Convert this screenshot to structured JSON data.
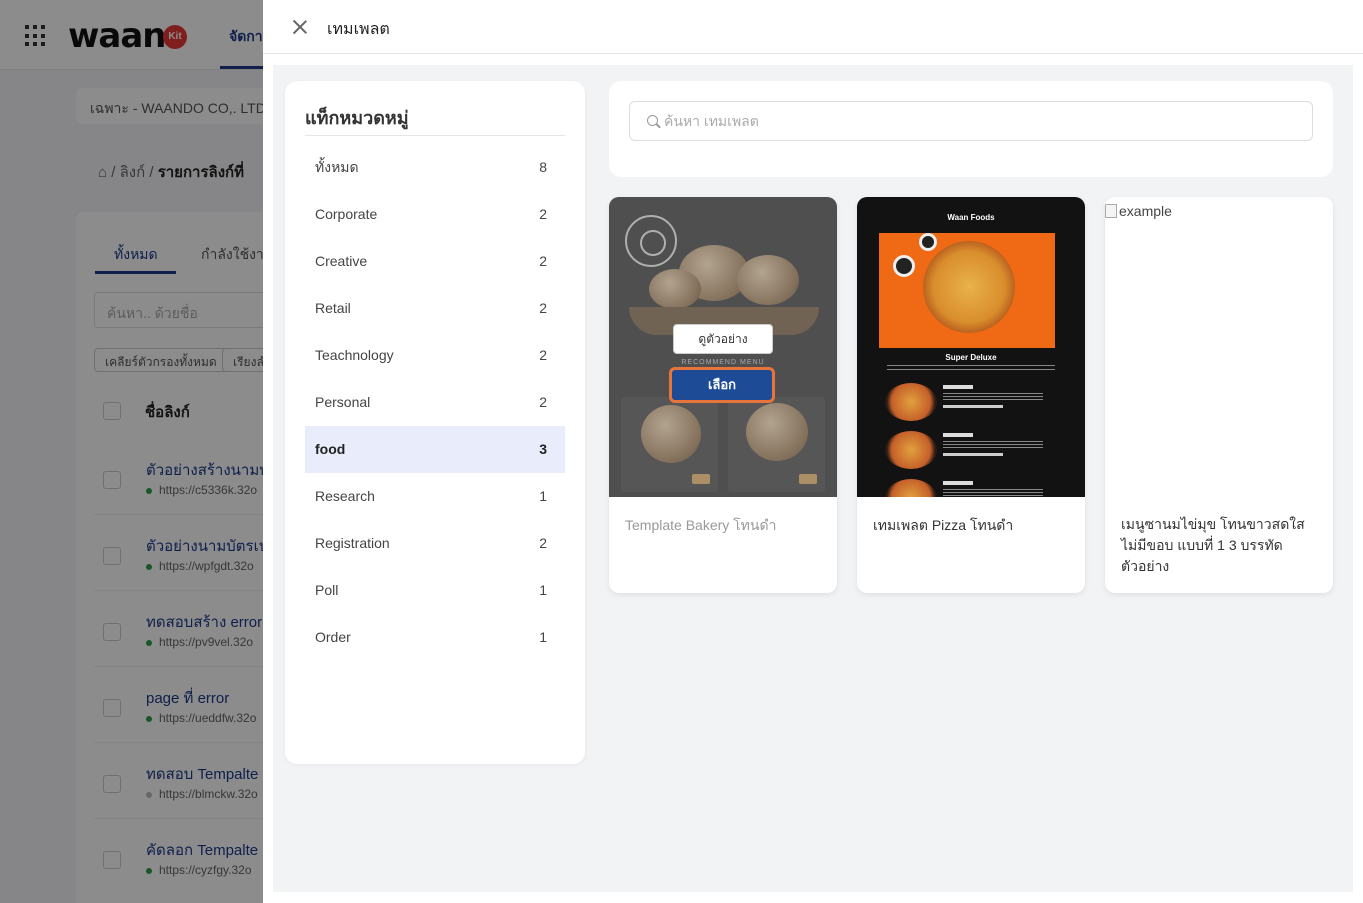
{
  "background": {
    "logo": "waan",
    "logo_badge": "Kit",
    "menu_label": "จัดการ",
    "org": "เฉพาะ - WAANDO CO,. LTD.",
    "breadcrumb": {
      "link": "ลิงก์",
      "current": "รายการลิงก์ที่"
    },
    "tabs": [
      "ทั้งหมด",
      "กำลังใช้งาน"
    ],
    "search_placeholder": "ค้นหา.. ด้วยชื่อ",
    "chips": [
      "เคลียร์ตัวกรองทั้งหมด",
      "เรียงลำ"
    ],
    "column_header": "ชื่อลิงก์",
    "rows": [
      {
        "title": "ตัวอย่างสร้างนามบั",
        "url": "https://c5336k.32o",
        "active": true
      },
      {
        "title": "ตัวอย่างนามบัตรเป",
        "url": "https://wpfgdt.32o",
        "active": true
      },
      {
        "title": "ทดสอบสร้าง error",
        "url": "https://pv9vel.32o",
        "active": true
      },
      {
        "title": "page ที่ error",
        "url": "https://ueddfw.32o",
        "active": true
      },
      {
        "title": "ทดสอบ Tempalte",
        "url": "https://blmckw.32o",
        "active": false
      },
      {
        "title": "คัดลอก Tempalte",
        "url": "https://cyzfgy.32o",
        "active": true
      }
    ]
  },
  "drawer": {
    "title": "เทมเพลต",
    "categories_title": "แท็กหมวดหมู่",
    "categories": [
      {
        "label": "ทั้งหมด",
        "count": "8",
        "active": false
      },
      {
        "label": "Corporate",
        "count": "2",
        "active": false
      },
      {
        "label": "Creative",
        "count": "2",
        "active": false
      },
      {
        "label": "Retail",
        "count": "2",
        "active": false
      },
      {
        "label": "Teachnology",
        "count": "2",
        "active": false
      },
      {
        "label": "Personal",
        "count": "2",
        "active": false
      },
      {
        "label": "food",
        "count": "3",
        "active": true
      },
      {
        "label": "Research",
        "count": "1",
        "active": false
      },
      {
        "label": "Registration",
        "count": "2",
        "active": false
      },
      {
        "label": "Poll",
        "count": "1",
        "active": false
      },
      {
        "label": "Order",
        "count": "1",
        "active": false
      }
    ],
    "search_placeholder": "ค้นหา เทมเพลต",
    "templates": [
      {
        "name": "Template Bakery โทนดำ",
        "preview_label": "ดูตัวอย่าง",
        "select_label": "เลือก",
        "thumb_text": "RECOMMEND MENU"
      },
      {
        "name": "เทมเพลต Pizza โทนดำ",
        "thumb_brand": "Waan Foods",
        "thumb_heading": "Super Deluxe"
      },
      {
        "name": "เมนูซานมไข่มุข โทนขาวสดใส ไม่มีขอบ แบบที่ 1 3 บรรทัดตัวอย่าง",
        "broken_alt": "example"
      }
    ],
    "colors": {
      "active_bg": "#e8ecfb",
      "select_button": "#1e4b96",
      "select_border": "#e8743a"
    }
  }
}
